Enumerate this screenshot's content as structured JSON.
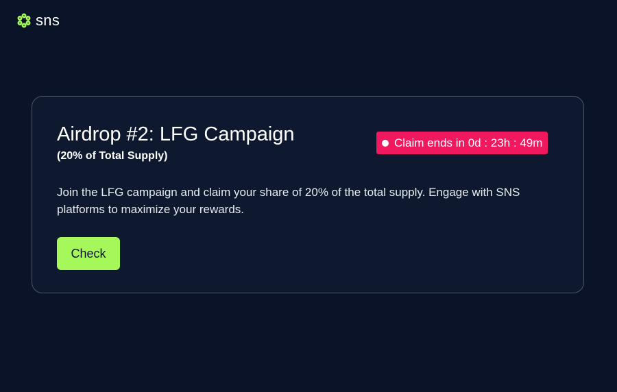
{
  "header": {
    "logo_icon": "sns-hexagon-logo-icon",
    "logo_text": "sns"
  },
  "campaign": {
    "title": "Airdrop #2: LFG Campaign",
    "subtitle": "(20% of Total Supply)",
    "countdown_text": "Claim ends in 0d : 23h : 49m",
    "description": "Join the LFG campaign and claim your share of 20% of the total supply. Engage with SNS platforms to maximize your rewards.",
    "check_label": "Check"
  },
  "colors": {
    "background": "#0a1328",
    "card_background": "#0e1930",
    "card_border": "#4a5568",
    "accent_green": "#a6f75a",
    "badge_pink": "#f0195f"
  }
}
